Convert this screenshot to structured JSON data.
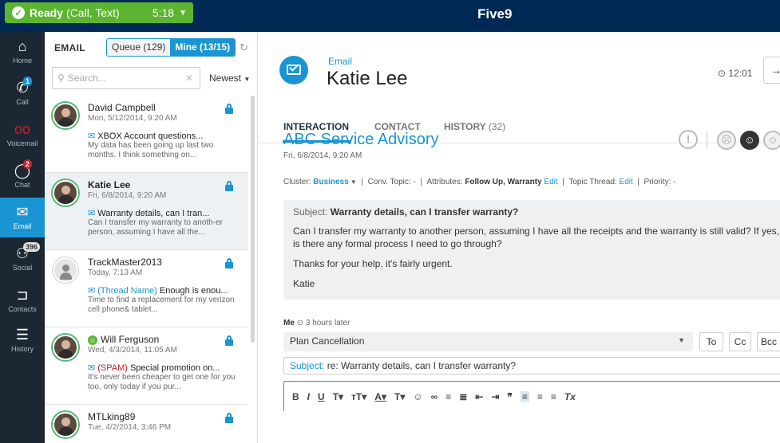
{
  "topbar": {
    "status": "Ready",
    "channels": "(Call, Text)",
    "timer": "5:18",
    "logo": "Five9"
  },
  "nav": [
    {
      "label": "Home",
      "icon": "home-icon",
      "badge": ""
    },
    {
      "label": "Call",
      "icon": "phone-icon",
      "badge": "1"
    },
    {
      "label": "Voicemail",
      "icon": "voicemail-icon",
      "badge": ""
    },
    {
      "label": "Chat",
      "icon": "chat-icon",
      "badge": "2"
    },
    {
      "label": "Email",
      "icon": "email-icon",
      "badge": ""
    },
    {
      "label": "Social",
      "icon": "social-icon",
      "badge": "396"
    },
    {
      "label": "Contacts",
      "icon": "folder-icon",
      "badge": ""
    },
    {
      "label": "History",
      "icon": "history-icon",
      "badge": ""
    }
  ],
  "list": {
    "title": "EMAIL",
    "queue_label": "Queue (129)",
    "mine_label": "Mine (13/15)",
    "search_placeholder": "Search...",
    "sort_label": "Newest",
    "items": [
      {
        "name": "David Campbell",
        "date": "Mon, 5/12/2014, 9:20 AM",
        "subject": "XBOX Account questions...",
        "tag": "",
        "preview": "My data has been going up last two months. I think something on..."
      },
      {
        "name": "Katie Lee",
        "date": "Fri, 6/8/2014, 9:20 AM",
        "subject": "Warranty details, can I tran...",
        "tag": "",
        "preview": "Can I transfer my warranty to anoth-er person, assuming I have all the..."
      },
      {
        "name": "TrackMaster2013",
        "date": "Today, 7:13 AM",
        "subject": "Enough is enou...",
        "tag": "(Thread Name)",
        "preview": "Time to find a replacement for my verizon cell phone& tablet..."
      },
      {
        "name": "Will Ferguson",
        "date": "Wed, 4/3/2014, 11:05 AM",
        "subject": "Special promotion on...",
        "tag": "(SPAM)",
        "preview": "It's never been cheaper to get one for you too, only today if you pur..."
      },
      {
        "name": "MTLking89",
        "date": "Tue, 4/2/2014, 3:46 PM",
        "subject": "",
        "tag": "",
        "preview": ""
      }
    ]
  },
  "main": {
    "channel": "Email",
    "contact_name": "Katie Lee",
    "time": "12:01",
    "tabs": [
      {
        "label": "INTERACTION",
        "count": ""
      },
      {
        "label": "CONTACT",
        "count": ""
      },
      {
        "label": "HISTORY",
        "count": "(32)"
      }
    ],
    "conversation_title": "ABC Service Advisory",
    "conversation_date": "Fri, 6/8/2014, 9:20 AM",
    "meta": {
      "cluster_label": "Cluster:",
      "cluster_value": "Business",
      "conv_topic": "Conv. Topic: -",
      "attributes_label": "Attributes:",
      "attributes_value": "Follow Up, Warranty",
      "edit": "Edit",
      "topic_thread_label": "Topic Thread:",
      "priority": "Priority: -"
    },
    "message": {
      "subject_label": "Subject:",
      "subject": "Warranty details, can I transfer warranty?",
      "body": "Can I transfer my warranty to another person, assuming I have all the receipts and the warranty is still valid? If yes, is there any formal process I need to go through?",
      "thanks": "Thanks for your help, it's fairly urgent.",
      "signature": "Katie"
    },
    "reply": {
      "author": "Me",
      "ago": "3 hours later",
      "disposition": "Plan Cancellation",
      "to": "To",
      "cc": "Cc",
      "bcc": "Bcc",
      "subject_label": "Subject:",
      "subject": "re: Warranty details, can I transfer warranty?"
    }
  }
}
